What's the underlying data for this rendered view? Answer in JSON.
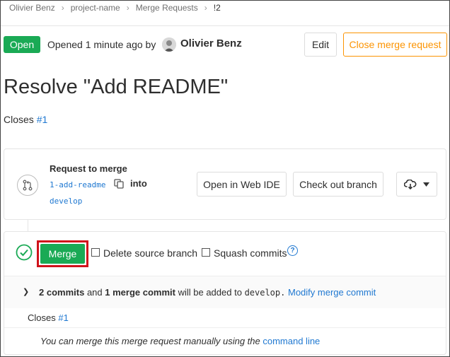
{
  "breadcrumb": {
    "items": [
      "Olivier Benz",
      "project-name",
      "Merge Requests",
      "!2"
    ],
    "separator": "›"
  },
  "header": {
    "status": "Open",
    "opened_text": "Opened 1 minute ago by",
    "author": "Olivier Benz",
    "edit_label": "Edit",
    "close_label": "Close merge request"
  },
  "title": "Resolve \"Add README\"",
  "description": {
    "closes_prefix": "Closes",
    "closes_link": "#1"
  },
  "widget": {
    "request_label": "Request to merge",
    "source_branch": "1-add-readme",
    "into_label": "into",
    "target_branch": "develop",
    "open_ide_label": "Open in Web IDE",
    "checkout_label": "Check out branch",
    "download_icon": "download-icon",
    "branch_icon": "merge-request-icon"
  },
  "merge": {
    "merge_label": "Merge",
    "delete_source_label": "Delete source branch",
    "squash_label": "Squash commits",
    "commits_bold": "2 commits",
    "and_text": "and",
    "merge_commit_bold": "1 merge commit",
    "will_be_added": "will be added to",
    "target": "develop.",
    "modify_link": "Modify merge commit",
    "closes_prefix": "Closes",
    "closes_link": "#1",
    "manual_text": "You can merge this merge request manually using the",
    "command_line_link": "command line"
  },
  "colors": {
    "green": "#1aaa55",
    "orange": "#fc9403",
    "link": "#1f78d1",
    "highlight": "#d0121b"
  }
}
